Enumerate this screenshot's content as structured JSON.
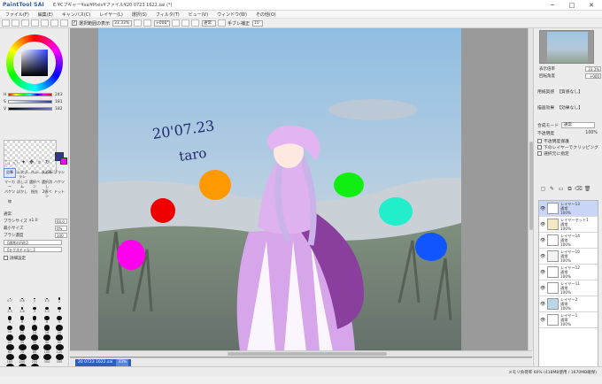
{
  "app": {
    "logo": "PaintTool SAI",
    "file_title": "E:¥Cプギャー¥sai¥Pixiv¥ファイル¥20 0723 1622.sai (*)",
    "win_minimize": "─",
    "win_maximize": "□",
    "win_close": "✕"
  },
  "menu": [
    "ファイル(F)",
    "編集(E)",
    "キャンバス(C)",
    "レイヤー(L)",
    "選択(S)",
    "フィルタ(T)",
    "ビュー(V)",
    "ウィンドウ(W)",
    "その他(O)"
  ],
  "toolbar": {
    "selection_label": "選択範囲の表示",
    "zoom_value": "33.33%",
    "angle_value": "+000°",
    "blend_value": "通常",
    "stabilizer_label": "手ブレ補正",
    "stabilizer_value": "10"
  },
  "color": {
    "fg": "#2a3a8c",
    "bg": "#ff00ff",
    "sliders": [
      {
        "label": "H",
        "value": "243",
        "gradient": "linear-gradient(to right, #f00, #ff0, #0f0, #0ff, #00f, #f0f, #f00)"
      },
      {
        "label": "S",
        "value": "181",
        "gradient": "linear-gradient(to right, #ffffff, #2a3a8c)"
      },
      {
        "label": "V",
        "value": "182",
        "gradient": "linear-gradient(to right, #000000, #6d76c9)"
      }
    ]
  },
  "tools": {
    "rows": [
      [
        "鉛筆",
        "エアブラシ",
        "ペン",
        "水彩筆",
        "ブラシ"
      ],
      [
        "マーカー",
        "消しゴム",
        "選択ペン",
        "選択消し",
        "バケツ"
      ],
      [
        "バケツ",
        "ぼかし",
        "指先",
        "2値ペン",
        "ドット"
      ],
      [
        "線",
        "",
        "",
        "",
        ""
      ]
    ],
    "selected_index": "0"
  },
  "brush": {
    "mode": "通常",
    "size_label": "ブラシサイズ",
    "size_mult": "x1.0",
    "size_value": "60.0",
    "min_size_label": "最小サイズ",
    "min_size_value": "0%",
    "density_label": "ブラシ濃度",
    "density_value": "100",
    "shape_label": "【通常の円形】",
    "texture_label": "【テクスチャなし】",
    "detail_label": "詳細設定"
  },
  "sizes": [
    "0.7",
    "0.8",
    "1",
    "1.5",
    "2",
    "2.3",
    "2.6",
    "3",
    "3.5",
    "4",
    "5",
    "6",
    "7",
    "8",
    "9",
    "10",
    "12",
    "14",
    "16",
    "20",
    "25",
    "30",
    "35",
    "40",
    "50",
    "60",
    "70",
    "80",
    "100",
    "120",
    "160",
    "200",
    "250",
    "300",
    "350",
    "400",
    "450",
    "500"
  ],
  "artwork": {
    "date_text": "20'07.23",
    "sign_text": "taro"
  },
  "doctab": {
    "name": "20 0723 1622.sai",
    "zoom": "33%"
  },
  "navigator": {
    "zoom_label": "表示倍率",
    "zoom_value": "33.3%",
    "angle_label": "回転角度",
    "angle_value": "+000"
  },
  "layer_props": {
    "paper_label": "用紙質感",
    "paper_value": "【質感なし】",
    "effect_label": "描画効果",
    "effect_value": "【効果なし】",
    "mode_label": "合成モード",
    "mode_value": "通常",
    "opacity_label": "不透明度",
    "opacity_value": "100%",
    "check1": "不透明度保護",
    "check2": "下のレイヤーでクリッピング",
    "check3": "選択元に指定"
  },
  "layers": [
    {
      "name": "レイヤー13",
      "mode": "通常",
      "opacity": "100%",
      "selected": true,
      "thumb": "#ffffff"
    },
    {
      "name": "レイヤーセット1",
      "mode": "通常",
      "opacity": "100%",
      "selected": false,
      "thumb": "#f4e9c0"
    },
    {
      "name": "レイヤー14",
      "mode": "通常",
      "opacity": "100%",
      "selected": false,
      "thumb": "#ffffff"
    },
    {
      "name": "レイヤー10",
      "mode": "通常",
      "opacity": "100%",
      "selected": false,
      "thumb": "#eef4f8"
    },
    {
      "name": "レイヤー12",
      "mode": "通常",
      "opacity": "100%",
      "selected": false,
      "thumb": "#ffffff"
    },
    {
      "name": "レイヤー11",
      "mode": "通常",
      "opacity": "100%",
      "selected": false,
      "thumb": "#ffffff"
    },
    {
      "name": "レイヤー2",
      "mode": "通常",
      "opacity": "100%",
      "selected": false,
      "thumb": "#b8d8ea"
    },
    {
      "name": "レイヤー1",
      "mode": "通常",
      "opacity": "100%",
      "selected": false,
      "thumb": "#ffffff"
    }
  ],
  "status": {
    "memory": "メモリ負荷率 60% (418MB使用 / 1670MB確保)"
  }
}
